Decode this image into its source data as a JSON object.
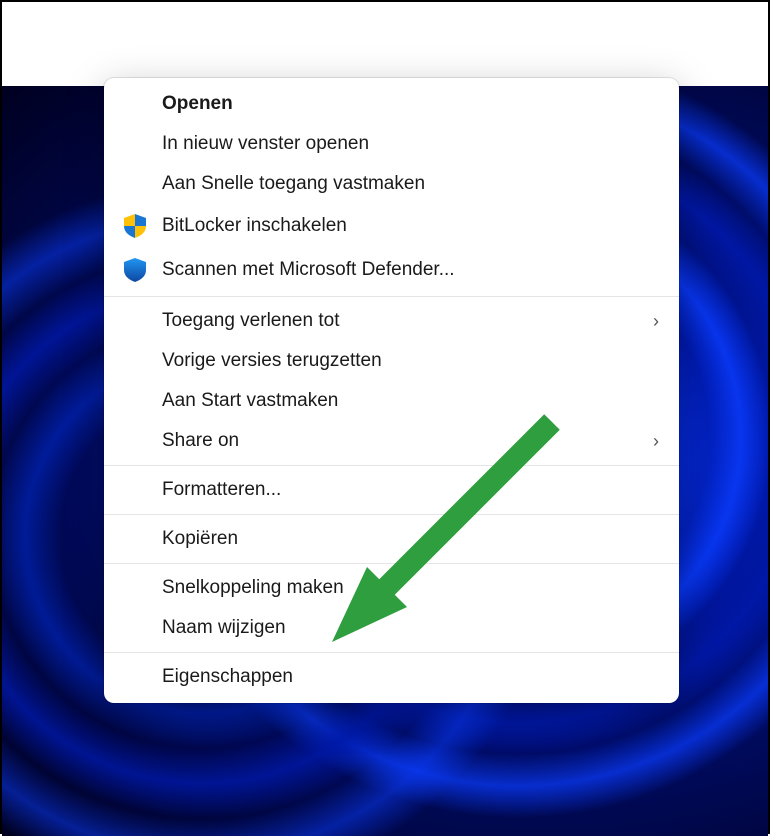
{
  "contextMenu": {
    "groups": [
      {
        "items": [
          {
            "label": "Openen",
            "bold": true,
            "icon": null,
            "submenu": false,
            "name": "menu-item-open"
          },
          {
            "label": "In nieuw venster openen",
            "bold": false,
            "icon": null,
            "submenu": false,
            "name": "menu-item-open-new-window"
          },
          {
            "label": "Aan Snelle toegang vastmaken",
            "bold": false,
            "icon": null,
            "submenu": false,
            "name": "menu-item-pin-quick-access"
          },
          {
            "label": "BitLocker inschakelen",
            "bold": false,
            "icon": "uac-shield",
            "submenu": false,
            "name": "menu-item-bitlocker"
          },
          {
            "label": "Scannen met Microsoft Defender...",
            "bold": false,
            "icon": "defender-shield",
            "submenu": false,
            "name": "menu-item-defender-scan"
          }
        ]
      },
      {
        "items": [
          {
            "label": "Toegang verlenen tot",
            "bold": false,
            "icon": null,
            "submenu": true,
            "name": "menu-item-grant-access"
          },
          {
            "label": "Vorige versies terugzetten",
            "bold": false,
            "icon": null,
            "submenu": false,
            "name": "menu-item-restore-versions"
          },
          {
            "label": "Aan Start vastmaken",
            "bold": false,
            "icon": null,
            "submenu": false,
            "name": "menu-item-pin-start"
          },
          {
            "label": "Share on",
            "bold": false,
            "icon": null,
            "submenu": true,
            "name": "menu-item-share-on"
          }
        ]
      },
      {
        "items": [
          {
            "label": "Formatteren...",
            "bold": false,
            "icon": null,
            "submenu": false,
            "name": "menu-item-format"
          }
        ]
      },
      {
        "items": [
          {
            "label": "Kopiëren",
            "bold": false,
            "icon": null,
            "submenu": false,
            "name": "menu-item-copy"
          }
        ]
      },
      {
        "items": [
          {
            "label": "Snelkoppeling maken",
            "bold": false,
            "icon": null,
            "submenu": false,
            "name": "menu-item-create-shortcut"
          },
          {
            "label": "Naam wijzigen",
            "bold": false,
            "icon": null,
            "submenu": false,
            "name": "menu-item-rename"
          }
        ]
      },
      {
        "items": [
          {
            "label": "Eigenschappen",
            "bold": false,
            "icon": null,
            "submenu": false,
            "name": "menu-item-properties"
          }
        ]
      }
    ]
  },
  "annotation": {
    "type": "arrow",
    "color": "#2e9e3f",
    "target": "menu-item-create-shortcut"
  }
}
